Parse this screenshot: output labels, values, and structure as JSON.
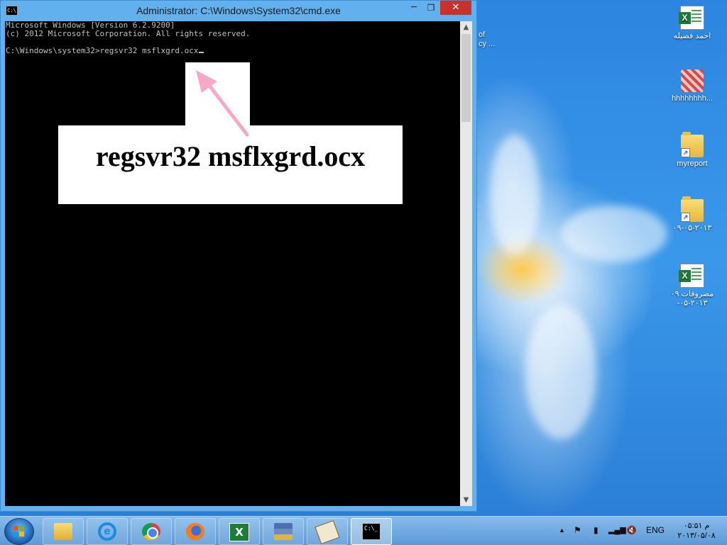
{
  "window": {
    "title": "Administrator: C:\\Windows\\System32\\cmd.exe",
    "icon_text": "C:\\",
    "controls": {
      "minimize": "─",
      "maximize": "❐",
      "close": "✕"
    }
  },
  "console": {
    "lines": [
      "Microsoft Windows [Version 6.2.9200]",
      "(c) 2012 Microsoft Corporation. All rights reserved.",
      "",
      "C:\\Windows\\system32>regsvr32 msflxgrd.ocx"
    ]
  },
  "callout": {
    "text": "regsvr32 msflxgrd.ocx",
    "arrow_color": "#f7a8c8"
  },
  "desktop_icons": [
    {
      "label": "احمد فضيله",
      "icon": "excel-file-icon"
    },
    {
      "label": "hhhhhhhh...",
      "icon": "pattern-image-icon"
    },
    {
      "label": "myreport",
      "icon": "folder-shortcut-icon"
    },
    {
      "label": "۰۹-۰۵-۲۰۱۳",
      "icon": "folder-shortcut-icon"
    },
    {
      "label_line1": "مصروفات ۰۹",
      "label_line2": "-۰۵-۲۰۱۳",
      "icon": "excel-file-icon"
    }
  ],
  "partial_desktop_text": {
    "line1": "of",
    "line2": "cy ..."
  },
  "taskbar": {
    "apps": [
      {
        "name": "file-explorer",
        "icon": "folder-icon"
      },
      {
        "name": "internet-explorer",
        "icon": "ie-icon",
        "glyph": "e"
      },
      {
        "name": "chrome",
        "icon": "chrome-icon"
      },
      {
        "name": "firefox",
        "icon": "firefox-icon"
      },
      {
        "name": "excel",
        "icon": "excel-icon",
        "glyph": "X"
      },
      {
        "name": "books-app",
        "icon": "books-icon"
      },
      {
        "name": "signing-app",
        "icon": "signature-icon"
      },
      {
        "name": "cmd",
        "icon": "cmd-icon",
        "glyph": "C:\\_",
        "active": true
      }
    ],
    "tray": {
      "language": "ENG",
      "time": "م ۰۵:۵۱",
      "date": "۲۰۱۳/۰۵/۰۸"
    }
  },
  "colors": {
    "titlebar": "#62b0ee",
    "close_button": "#c7322b",
    "console_bg": "#000000",
    "console_text": "#c0c0c0"
  }
}
